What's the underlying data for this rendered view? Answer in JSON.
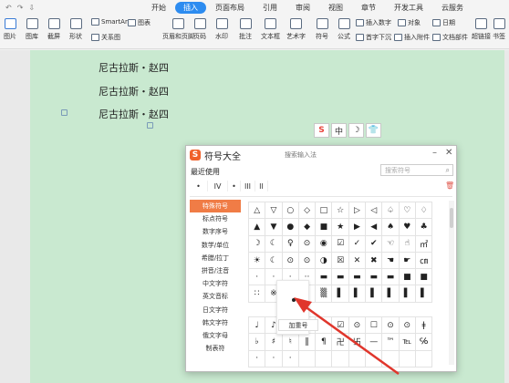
{
  "menubar": {
    "quick_access": [
      "↶",
      "↷",
      "⇩"
    ],
    "tabs": [
      "开始",
      "插入",
      "页面布局",
      "引用",
      "审阅",
      "视图",
      "章节",
      "开发工具",
      "云服务"
    ],
    "active_tab": "插入",
    "accent": "#2d8cf0"
  },
  "ribbon": {
    "large": [
      "图片",
      "图库",
      "截屏",
      "形状",
      "页眉和页脚",
      "页码",
      "水印",
      "批注",
      "文本框",
      "艺术字",
      "符号",
      "公式"
    ],
    "small": [
      "SmartArt",
      "图表",
      "关系图",
      "首字下沉",
      "插入数字",
      "对象",
      "插入附件",
      "日期",
      "文档部件",
      "超链接",
      "书签"
    ]
  },
  "document": {
    "lines": [
      "尼古拉斯・赵四",
      "尼古拉斯・赵四",
      "尼古拉斯・赵四"
    ],
    "page_color": "#c9e9d0"
  },
  "float_toolbar": [
    "S",
    "中",
    "☽",
    "👕"
  ],
  "dialog": {
    "title": "符号大全",
    "search_placeholder": "搜索输入法",
    "recent_label": "最近使用",
    "symbol_search_placeholder": "搜索符号",
    "recent_symbols": [
      "•",
      "IV",
      "•",
      "III",
      "II"
    ],
    "categories": [
      "特殊符号",
      "标点符号",
      "数字序号",
      "数学/单位",
      "希腊/拉丁",
      "拼音/注音",
      "中文字符",
      "英文音标",
      "日文字符",
      "韩文字符",
      "俄文字母",
      "制表符"
    ],
    "active_category": "特殊符号",
    "active_color": "#f07c46",
    "grid": [
      [
        "△",
        "▽",
        "○",
        "◇",
        "□",
        "☆",
        "▷",
        "◁",
        "♤",
        "♡",
        "♢"
      ],
      [
        "▲",
        "▼",
        "●",
        "◆",
        "■",
        "★",
        "▶",
        "◀",
        "♠",
        "♥",
        "♣"
      ],
      [
        "☽",
        "☾",
        "♀",
        "⊙",
        "◉",
        "☑",
        "✓",
        "✔",
        "☜",
        "☝",
        "㎡"
      ],
      [
        "☀",
        "☾",
        "⊙",
        "⊙",
        "◑",
        "☒",
        "✕",
        "✖",
        "☚",
        "☛",
        "㎝"
      ],
      [
        "·",
        "·",
        "·",
        "··",
        "▬",
        "▬",
        "▬",
        "▬",
        "▬",
        "■",
        "■"
      ],
      [
        "∷",
        "※",
        "",
        "",
        "▒",
        "▌",
        "▌",
        "▌",
        "▌",
        "▌",
        "▌"
      ]
    ],
    "grid2": [
      [
        "♩",
        "♪",
        "",
        "",
        "",
        "☑",
        "⊙",
        "☐",
        "⊙",
        "⊙",
        "ǂ"
      ],
      [
        "♭",
        "♯",
        "♮",
        "‖",
        "¶",
        "卍",
        "卐",
        "—",
        "™",
        "℡",
        "℅"
      ],
      [
        "·",
        "·",
        "·",
        "",
        "",
        "",
        "",
        "",
        "",
        "",
        ""
      ]
    ],
    "tooltip": "加重号"
  },
  "arrow_color": "#e0362c"
}
